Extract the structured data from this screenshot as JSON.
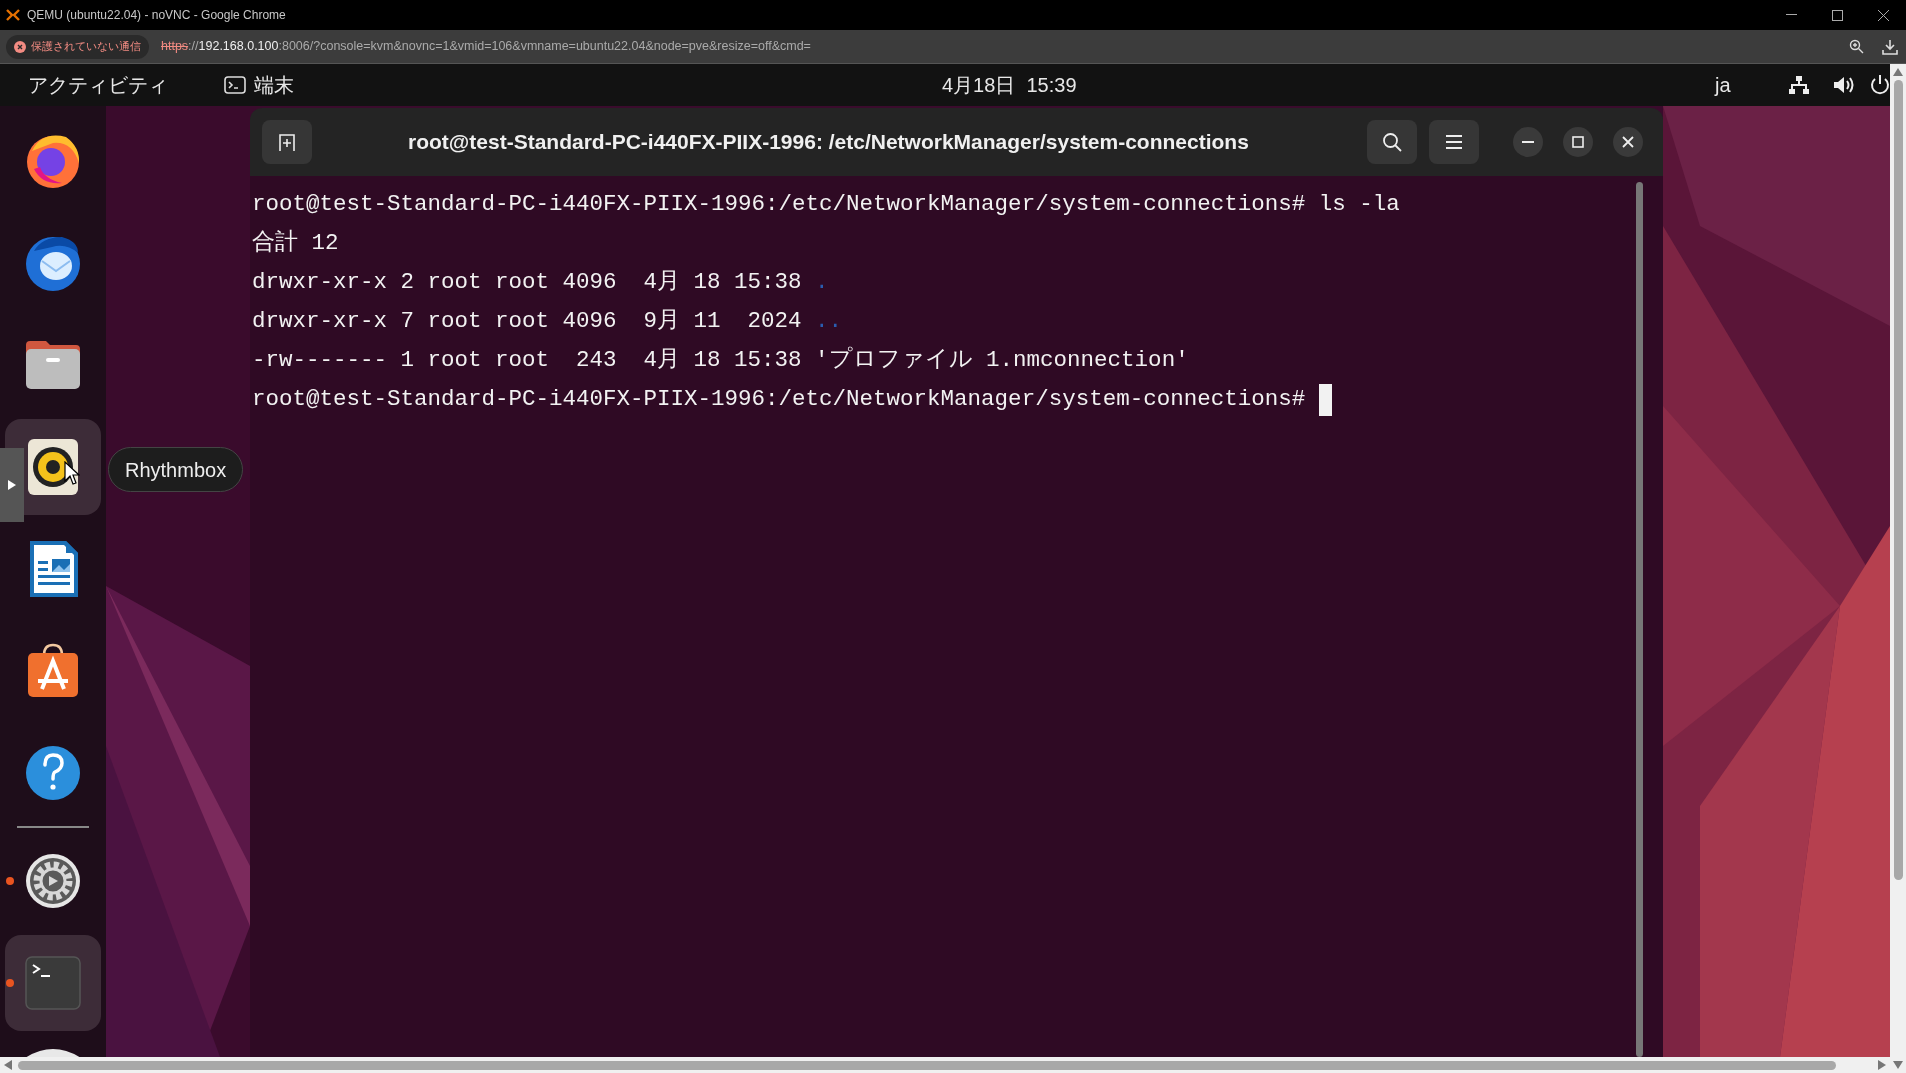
{
  "browser": {
    "title": "QEMU (ubuntu22.04) - noVNC - Google Chrome",
    "security_chip": "保護されていない通信",
    "url": {
      "scheme": "https",
      "separator": "://",
      "host": "192.168.0.100",
      "rest": ":8006/?console=kvm&novnc=1&vmid=106&vmname=ubuntu22.04&node=pve&resize=off&cmd="
    }
  },
  "top_bar": {
    "activities": "アクティビティ",
    "app_name": "端末",
    "clock": "4月18日  15:39",
    "input_method": "ja"
  },
  "dock": {
    "items": [
      {
        "kind": "browser",
        "running": false,
        "highlighted": false
      },
      {
        "kind": "mail",
        "running": false,
        "highlighted": false
      },
      {
        "kind": "files",
        "running": false,
        "highlighted": false
      },
      {
        "kind": "music",
        "running": false,
        "highlighted": true
      },
      {
        "kind": "document",
        "running": false,
        "highlighted": false
      },
      {
        "kind": "store",
        "running": false,
        "highlighted": false
      },
      {
        "kind": "help",
        "running": false,
        "highlighted": false
      },
      {
        "kind": "separator",
        "running": false,
        "highlighted": false
      },
      {
        "kind": "settings",
        "running": true,
        "highlighted": false
      },
      {
        "kind": "terminal",
        "running": true,
        "highlighted": true
      }
    ]
  },
  "tooltip": "Rhythmbox",
  "terminal": {
    "title": "root@test-Standard-PC-i440FX-PIIX-1996: /etc/NetworkManager/system-connections",
    "lines": [
      {
        "text": "root@test-Standard-PC-i440FX-PIIX-1996:/etc/NetworkManager/system-connections# ls -la",
        "cursor": false
      },
      {
        "text": "合計 12",
        "cursor": false
      },
      {
        "text": "drwxr-xr-x 2 root root 4096  4月 18 15:38 ",
        "file": {
          "name": ".",
          "kind": "directory"
        },
        "cursor": false
      },
      {
        "text": "drwxr-xr-x 7 root root 4096  9月 11  2024 ",
        "file": {
          "name": "..",
          "kind": "directory"
        },
        "cursor": false
      },
      {
        "text": "-rw------- 1 root root  243  4月 18 15:38 ",
        "file": {
          "name": "'プロファイル 1.nmconnection'",
          "kind": "file"
        },
        "cursor": false
      },
      {
        "text": "root@test-Standard-PC-i440FX-PIIX-1996:/etc/NetworkManager/system-connections# ",
        "cursor": true
      }
    ]
  }
}
